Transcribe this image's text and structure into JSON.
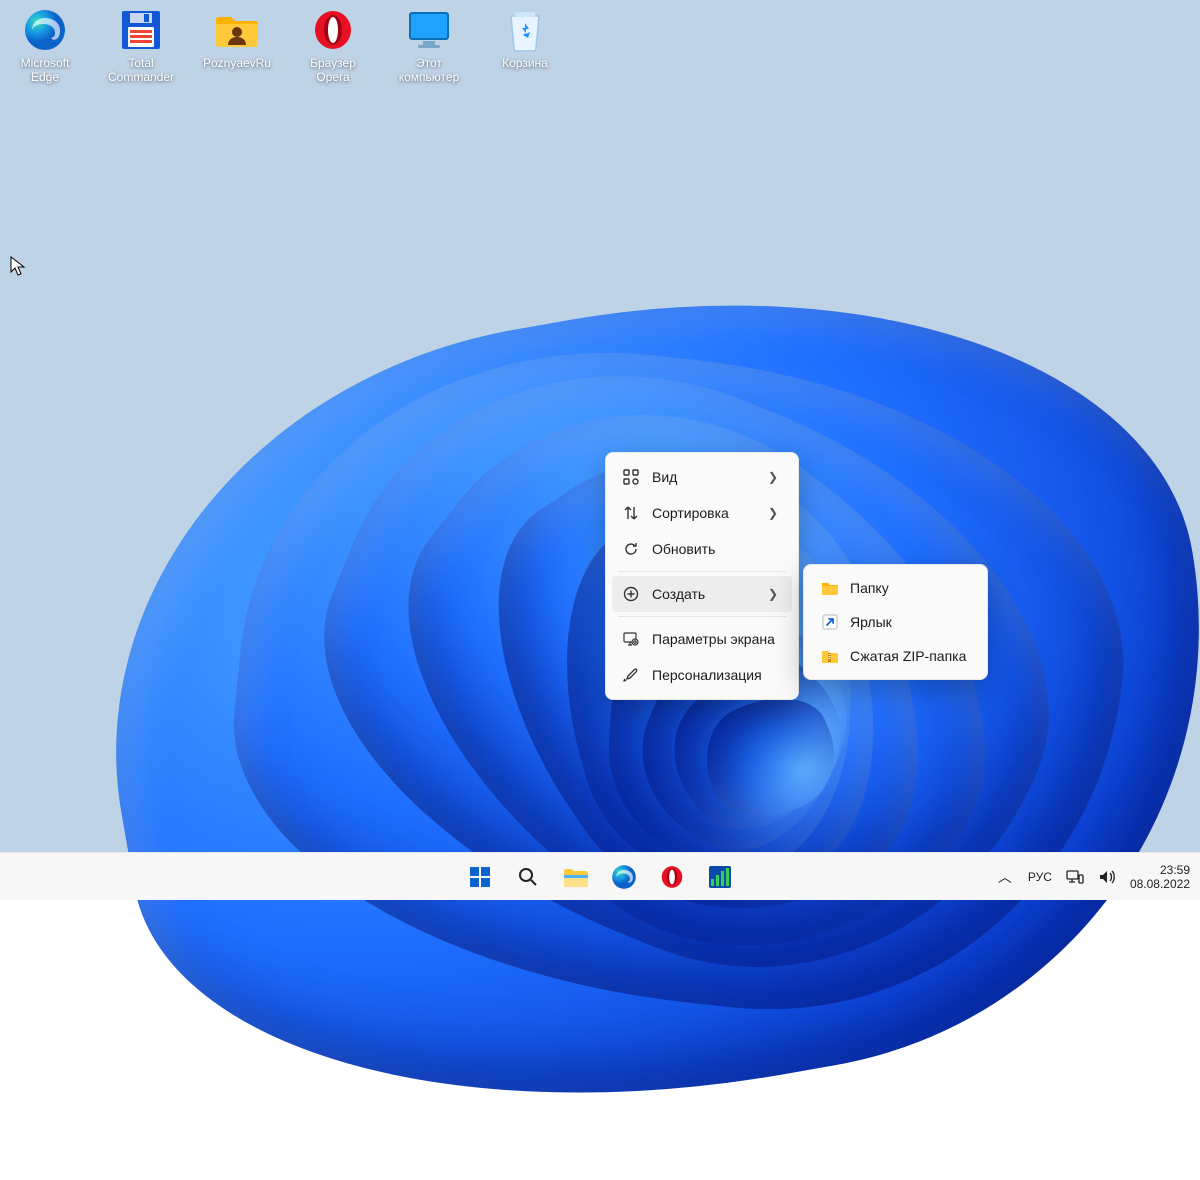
{
  "desktop": {
    "icons": [
      {
        "id": "edge",
        "label": "Microsoft\nEdge",
        "icon": "edge"
      },
      {
        "id": "tcmd",
        "label": "Total\nCommander",
        "icon": "floppy-tc"
      },
      {
        "id": "pozn",
        "label": "PoznyaevRu",
        "icon": "folder-user"
      },
      {
        "id": "opera",
        "label": "Браузер\nOpera",
        "icon": "opera"
      },
      {
        "id": "thispc",
        "label": "Этот\nкомпьютер",
        "icon": "monitor"
      },
      {
        "id": "trash",
        "label": "Корзина",
        "icon": "recycle-bin"
      }
    ]
  },
  "context_menu": {
    "items": [
      {
        "icon": "view",
        "label": "Вид",
        "has_sub": true
      },
      {
        "icon": "sort",
        "label": "Сортировка",
        "has_sub": true
      },
      {
        "icon": "refresh",
        "label": "Обновить",
        "has_sub": false
      },
      {
        "sep": true
      },
      {
        "icon": "plus",
        "label": "Создать",
        "has_sub": true,
        "hover": true
      },
      {
        "sep": true
      },
      {
        "icon": "display-gear",
        "label": "Параметры экрана",
        "has_sub": false
      },
      {
        "icon": "brush",
        "label": "Персонализация",
        "has_sub": false
      }
    ],
    "submenu": [
      {
        "icon": "folder-mini",
        "label": "Папку"
      },
      {
        "icon": "shortcut-mini",
        "label": "Ярлык"
      },
      {
        "icon": "zip-mini",
        "label": "Сжатая ZIP-папка"
      }
    ]
  },
  "taskbar": {
    "pinned": [
      "start",
      "search",
      "explorer",
      "edge",
      "opera",
      "monitor-app"
    ]
  },
  "tray": {
    "overflow_chevron": "^",
    "language": "РУС",
    "time": "23:59",
    "date": "08.08.2022"
  }
}
